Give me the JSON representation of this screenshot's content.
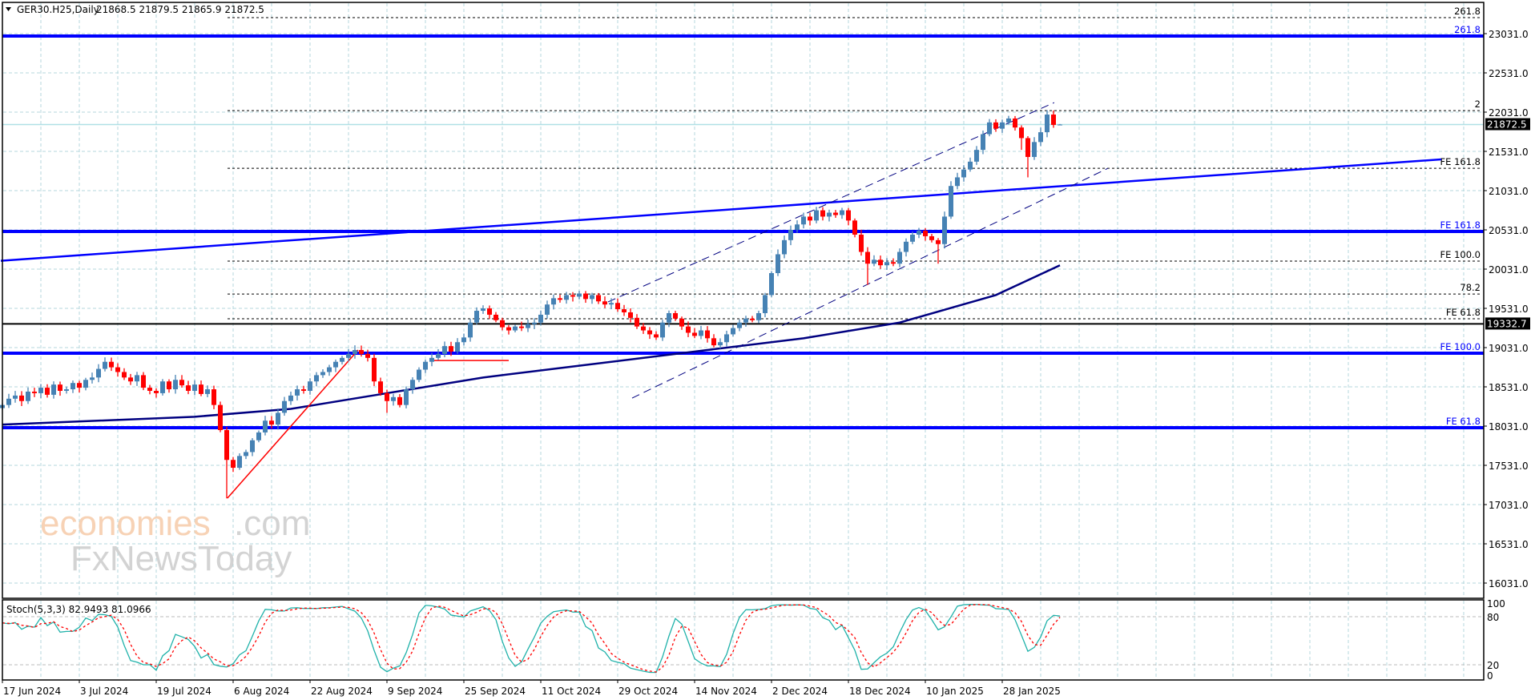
{
  "header": {
    "symbol_timeframe": "GER30.H25,Daily",
    "ohlc": "21868.5 21879.5 21865.9 21872.5"
  },
  "stoch_label": "Stoch(5,3,3) 82.9493 81.0966",
  "watermark": {
    "brand": "economies",
    "tld": ".com",
    "sub": "FxNewsToday"
  },
  "colors": {
    "bull": "#4682B4",
    "bear": "#FF0000",
    "grid": "#B4D7DC",
    "level": "#0000FF",
    "ma": "#000080",
    "stoch_main": "#20B2AA",
    "stoch_signal": "#FF0000"
  },
  "chart_data": {
    "type": "candlestick",
    "title": "GER30.H25,Daily",
    "ylim": [
      15900,
      23300
    ],
    "y_ticks": [
      "23031.0",
      "22531.0",
      "22031.0",
      "21531.0",
      "21031.0",
      "20531.0",
      "20031.0",
      "19531.0",
      "19031.0",
      "18531.0",
      "18031.0",
      "17531.0",
      "17031.0",
      "16531.0",
      "16031.0"
    ],
    "x_ticks": [
      "17 Jun 2024",
      "3 Jul 2024",
      "19 Jul 2024",
      "6 Aug 2024",
      "22 Aug 2024",
      "9 Sep 2024",
      "25 Sep 2024",
      "11 Oct 2024",
      "29 Oct 2024",
      "14 Nov 2024",
      "2 Dec 2024",
      "18 Dec 2024",
      "10 Jan 2025",
      "28 Jan 2025"
    ],
    "bars_per_x_tick": 12,
    "closes": [
      18300,
      18380,
      18420,
      18350,
      18470,
      18450,
      18520,
      18430,
      18560,
      18480,
      18500,
      18580,
      18520,
      18620,
      18650,
      18760,
      18850,
      18780,
      18720,
      18650,
      18600,
      18680,
      18520,
      18480,
      18450,
      18600,
      18500,
      18620,
      18550,
      18480,
      18560,
      18440,
      18500,
      18300,
      17980,
      17600,
      17500,
      17650,
      17700,
      17850,
      17950,
      18100,
      18050,
      18200,
      18350,
      18420,
      18500,
      18480,
      18600,
      18680,
      18720,
      18780,
      18850,
      18900,
      18950,
      19000,
      18950,
      18900,
      18600,
      18450,
      18350,
      18400,
      18300,
      18500,
      18620,
      18750,
      18850,
      18900,
      18950,
      19050,
      18980,
      19100,
      19160,
      19350,
      19500,
      19530,
      19450,
      19380,
      19290,
      19250,
      19300,
      19280,
      19330,
      19350,
      19450,
      19580,
      19660,
      19640,
      19700,
      19680,
      19720,
      19650,
      19700,
      19620,
      19580,
      19600,
      19520,
      19480,
      19410,
      19300,
      19250,
      19200,
      19160,
      19350,
      19470,
      19400,
      19300,
      19220,
      19180,
      19250,
      19150,
      19060,
      19100,
      19200,
      19280,
      19350,
      19400,
      19380,
      19470,
      19700,
      19980,
      20220,
      20400,
      20530,
      20600,
      20700,
      20650,
      20780,
      20700,
      20750,
      20720,
      20780,
      20650,
      20470,
      20250,
      20100,
      20150,
      20080,
      20120,
      20100,
      20250,
      20380,
      20470,
      20520,
      20450,
      20400,
      20350,
      20700,
      21090,
      21200,
      21300,
      21400,
      21550,
      21750,
      21900,
      21820,
      21900,
      21950,
      21835,
      21700,
      21460,
      21650,
      21775,
      22000,
      21868.5,
      21872.5
    ],
    "low_overrides": {
      "35": 17110,
      "60": 18200,
      "135": 19830,
      "146": 20100,
      "160": 21200,
      "159": 21550
    },
    "last_candle": {
      "open": 21868.5,
      "high": 21879.5,
      "low": 21865.9,
      "close": 21872.5
    },
    "moving_average": {
      "points": [
        [
          0,
          18050
        ],
        [
          30,
          18150
        ],
        [
          45,
          18250
        ],
        [
          60,
          18450
        ],
        [
          75,
          18650
        ],
        [
          90,
          18800
        ],
        [
          110,
          19000
        ],
        [
          125,
          19150
        ],
        [
          140,
          19350
        ],
        [
          155,
          19700
        ],
        [
          165,
          20080
        ]
      ]
    },
    "horizontal_levels": [
      {
        "label": "261.8",
        "price": 23000,
        "style": "thick-blue"
      },
      {
        "label": "FE 161.8",
        "price": 20510,
        "style": "thick-blue"
      },
      {
        "label": "FE 100.0",
        "price": 18960,
        "style": "thick-blue"
      },
      {
        "label": "FE 61.8",
        "price": 18010,
        "style": "thick-blue"
      },
      {
        "label": "261.8",
        "price": 23235,
        "style": "dotted"
      },
      {
        "label": "2",
        "price": 22050,
        "style": "dotted"
      },
      {
        "label": "FE 161.8",
        "price": 21316,
        "style": "dotted"
      },
      {
        "label": "FE 100.0",
        "price": 20133,
        "style": "dotted"
      },
      {
        "label": "78.2",
        "price": 19714,
        "style": "dotted"
      },
      {
        "label": "FE 61.8",
        "price": 19398,
        "style": "dotted"
      }
    ],
    "marked_prices": [
      {
        "label": "21872.5",
        "price": 21872.5,
        "line": "#B0E0E6"
      },
      {
        "label": "19332.7",
        "price": 19332.7,
        "line": "#000000"
      }
    ],
    "trendline": {
      "from": [
        -0.25,
        20137
      ],
      "to": [
        224.5,
        21429
      ]
    },
    "channel": {
      "upper": {
        "from": [
          94.5,
          19613
        ],
        "to": [
          164.1,
          22152
        ]
      },
      "lower": {
        "from": [
          98.25,
          18388
        ],
        "to": [
          172.5,
          21316
        ]
      }
    },
    "red_lines": [
      {
        "from": [
          35.1,
          17113
        ],
        "to": [
          55.5,
          19000
        ]
      },
      {
        "from": [
          67,
          18867
        ],
        "to": [
          79,
          18867
        ]
      }
    ],
    "stochastic": {
      "k": 82.9493,
      "d": 81.0966,
      "levels": [
        20,
        80
      ],
      "y_ticks": [
        "100",
        "80",
        "20",
        "0"
      ]
    }
  }
}
